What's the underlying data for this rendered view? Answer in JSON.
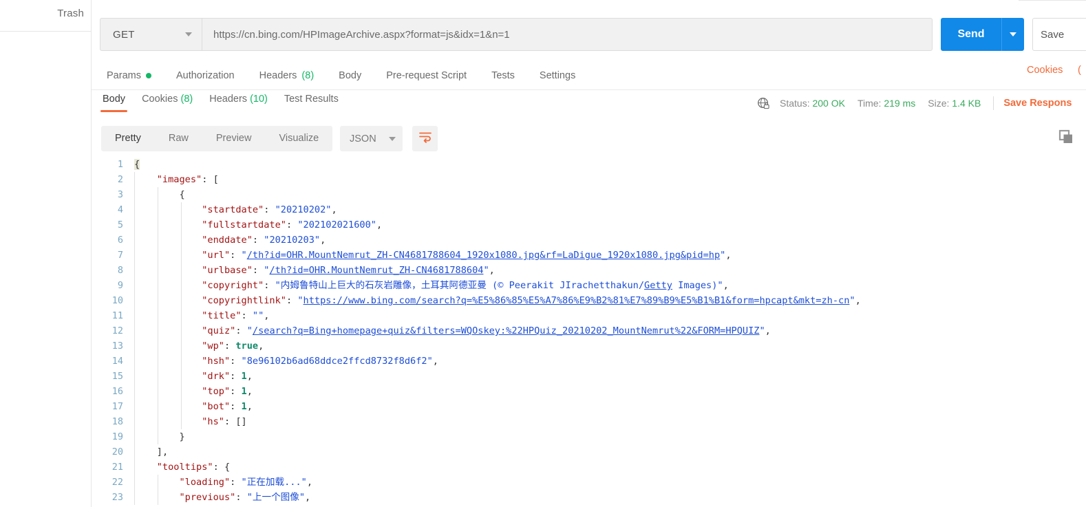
{
  "sidebar": {
    "trash_label": "Trash"
  },
  "request": {
    "method": "GET",
    "url": "https://cn.bing.com/HPImageArchive.aspx?format=js&idx=1&n=1",
    "send_label": "Send",
    "save_label": "Save",
    "tabs": [
      {
        "label": "Params",
        "dot": true
      },
      {
        "label": "Authorization"
      },
      {
        "label": "Headers",
        "count": "(8)"
      },
      {
        "label": "Body"
      },
      {
        "label": "Pre-request Script"
      },
      {
        "label": "Tests"
      },
      {
        "label": "Settings"
      }
    ],
    "cookies_label": "Cookies",
    "cookies_paren": "("
  },
  "response": {
    "tabs": [
      {
        "label": "Body",
        "active": true
      },
      {
        "label": "Cookies",
        "count": "(8)"
      },
      {
        "label": "Headers",
        "count": "(10)"
      },
      {
        "label": "Test Results"
      }
    ],
    "status_label": "Status:",
    "status_value": "200 OK",
    "time_label": "Time:",
    "time_value": "219 ms",
    "size_label": "Size:",
    "size_value": "1.4 KB",
    "save_response_label": "Save Respons",
    "format_tabs": [
      {
        "label": "Pretty",
        "active": true
      },
      {
        "label": "Raw"
      },
      {
        "label": "Preview"
      },
      {
        "label": "Visualize"
      }
    ],
    "language": "JSON"
  },
  "colors": {
    "accent_orange": "#f26b3a",
    "send_blue": "#1089e8",
    "status_green": "#3aab5e",
    "json_key": "#a31515",
    "json_string": "#1d4ed8",
    "json_number": "#0f8a6a"
  },
  "body_json": {
    "lines": [
      {
        "n": 1,
        "indent": 0,
        "parts": [
          {
            "t": "brace",
            "v": "{",
            "hl": true
          }
        ]
      },
      {
        "n": 2,
        "indent": 1,
        "parts": [
          {
            "t": "key",
            "v": "\"images\""
          },
          {
            "t": "punc",
            "v": ": "
          },
          {
            "t": "brace",
            "v": "["
          }
        ]
      },
      {
        "n": 3,
        "indent": 2,
        "parts": [
          {
            "t": "brace",
            "v": "{"
          }
        ]
      },
      {
        "n": 4,
        "indent": 3,
        "parts": [
          {
            "t": "key",
            "v": "\"startdate\""
          },
          {
            "t": "punc",
            "v": ": "
          },
          {
            "t": "str",
            "v": "\"20210202\""
          },
          {
            "t": "punc",
            "v": ","
          }
        ]
      },
      {
        "n": 5,
        "indent": 3,
        "parts": [
          {
            "t": "key",
            "v": "\"fullstartdate\""
          },
          {
            "t": "punc",
            "v": ": "
          },
          {
            "t": "str",
            "v": "\"202102021600\""
          },
          {
            "t": "punc",
            "v": ","
          }
        ]
      },
      {
        "n": 6,
        "indent": 3,
        "parts": [
          {
            "t": "key",
            "v": "\"enddate\""
          },
          {
            "t": "punc",
            "v": ": "
          },
          {
            "t": "str",
            "v": "\"20210203\""
          },
          {
            "t": "punc",
            "v": ","
          }
        ]
      },
      {
        "n": 7,
        "indent": 3,
        "parts": [
          {
            "t": "key",
            "v": "\"url\""
          },
          {
            "t": "punc",
            "v": ": "
          },
          {
            "t": "str",
            "v": "\""
          },
          {
            "t": "link",
            "v": "/th?id=OHR.MountNemrut_ZH-CN4681788604_1920x1080.jpg&rf=LaDigue_1920x1080.jpg&pid=hp"
          },
          {
            "t": "str",
            "v": "\""
          },
          {
            "t": "punc",
            "v": ","
          }
        ]
      },
      {
        "n": 8,
        "indent": 3,
        "parts": [
          {
            "t": "key",
            "v": "\"urlbase\""
          },
          {
            "t": "punc",
            "v": ": "
          },
          {
            "t": "str",
            "v": "\""
          },
          {
            "t": "link",
            "v": "/th?id=OHR.MountNemrut_ZH-CN4681788604"
          },
          {
            "t": "str",
            "v": "\""
          },
          {
            "t": "punc",
            "v": ","
          }
        ]
      },
      {
        "n": 9,
        "indent": 3,
        "parts": [
          {
            "t": "key",
            "v": "\"copyright\""
          },
          {
            "t": "punc",
            "v": ": "
          },
          {
            "t": "str",
            "v": "\"内姆鲁特山上巨大的石灰岩雕像，土耳其阿德亚曼 (© Peerakit JIrachetthakun/"
          },
          {
            "t": "link",
            "v": "Getty"
          },
          {
            "t": "str",
            "v": " Images)\""
          },
          {
            "t": "punc",
            "v": ","
          }
        ]
      },
      {
        "n": 10,
        "indent": 3,
        "parts": [
          {
            "t": "key",
            "v": "\"copyrightlink\""
          },
          {
            "t": "punc",
            "v": ": "
          },
          {
            "t": "str",
            "v": "\""
          },
          {
            "t": "link",
            "v": "https://www.bing.com/search?q=%E5%86%85%E5%A7%86%E9%B2%81%E7%89%B9%E5%B1%B1&form=hpcapt&mkt=zh-cn"
          },
          {
            "t": "str",
            "v": "\""
          },
          {
            "t": "punc",
            "v": ","
          }
        ]
      },
      {
        "n": 11,
        "indent": 3,
        "parts": [
          {
            "t": "key",
            "v": "\"title\""
          },
          {
            "t": "punc",
            "v": ": "
          },
          {
            "t": "str",
            "v": "\"\""
          },
          {
            "t": "punc",
            "v": ","
          }
        ]
      },
      {
        "n": 12,
        "indent": 3,
        "parts": [
          {
            "t": "key",
            "v": "\"quiz\""
          },
          {
            "t": "punc",
            "v": ": "
          },
          {
            "t": "str",
            "v": "\""
          },
          {
            "t": "link",
            "v": "/search?q=Bing+homepage+quiz&filters=WQOskey:%22HPQuiz_20210202_MountNemrut%22&FORM=HPQUIZ"
          },
          {
            "t": "str",
            "v": "\""
          },
          {
            "t": "punc",
            "v": ","
          }
        ]
      },
      {
        "n": 13,
        "indent": 3,
        "parts": [
          {
            "t": "key",
            "v": "\"wp\""
          },
          {
            "t": "punc",
            "v": ": "
          },
          {
            "t": "bool",
            "v": "true"
          },
          {
            "t": "punc",
            "v": ","
          }
        ]
      },
      {
        "n": 14,
        "indent": 3,
        "parts": [
          {
            "t": "key",
            "v": "\"hsh\""
          },
          {
            "t": "punc",
            "v": ": "
          },
          {
            "t": "str",
            "v": "\"8e96102b6ad68ddce2ffcd8732f8d6f2\""
          },
          {
            "t": "punc",
            "v": ","
          }
        ]
      },
      {
        "n": 15,
        "indent": 3,
        "parts": [
          {
            "t": "key",
            "v": "\"drk\""
          },
          {
            "t": "punc",
            "v": ": "
          },
          {
            "t": "num",
            "v": "1"
          },
          {
            "t": "punc",
            "v": ","
          }
        ]
      },
      {
        "n": 16,
        "indent": 3,
        "parts": [
          {
            "t": "key",
            "v": "\"top\""
          },
          {
            "t": "punc",
            "v": ": "
          },
          {
            "t": "num",
            "v": "1"
          },
          {
            "t": "punc",
            "v": ","
          }
        ]
      },
      {
        "n": 17,
        "indent": 3,
        "parts": [
          {
            "t": "key",
            "v": "\"bot\""
          },
          {
            "t": "punc",
            "v": ": "
          },
          {
            "t": "num",
            "v": "1"
          },
          {
            "t": "punc",
            "v": ","
          }
        ]
      },
      {
        "n": 18,
        "indent": 3,
        "parts": [
          {
            "t": "key",
            "v": "\"hs\""
          },
          {
            "t": "punc",
            "v": ": "
          },
          {
            "t": "brace",
            "v": "[]"
          }
        ]
      },
      {
        "n": 19,
        "indent": 2,
        "parts": [
          {
            "t": "brace",
            "v": "}"
          }
        ]
      },
      {
        "n": 20,
        "indent": 1,
        "parts": [
          {
            "t": "brace",
            "v": "]"
          },
          {
            "t": "punc",
            "v": ","
          }
        ]
      },
      {
        "n": 21,
        "indent": 1,
        "parts": [
          {
            "t": "key",
            "v": "\"tooltips\""
          },
          {
            "t": "punc",
            "v": ": "
          },
          {
            "t": "brace",
            "v": "{"
          }
        ]
      },
      {
        "n": 22,
        "indent": 2,
        "parts": [
          {
            "t": "key",
            "v": "\"loading\""
          },
          {
            "t": "punc",
            "v": ": "
          },
          {
            "t": "str",
            "v": "\"正在加载...\""
          },
          {
            "t": "punc",
            "v": ","
          }
        ]
      },
      {
        "n": 23,
        "indent": 2,
        "parts": [
          {
            "t": "key",
            "v": "\"previous\""
          },
          {
            "t": "punc",
            "v": ": "
          },
          {
            "t": "str",
            "v": "\"上一个图像\""
          },
          {
            "t": "punc",
            "v": ","
          }
        ]
      }
    ]
  },
  "icons": {
    "globe_lock": "globe-lock-icon",
    "wrap": "word-wrap-icon",
    "copy": "copy-icon"
  }
}
